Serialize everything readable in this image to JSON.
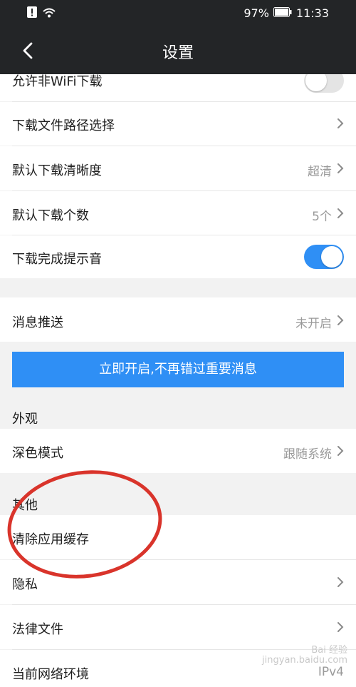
{
  "status_bar": {
    "battery_percent": "97%",
    "time": "11:33",
    "icons": [
      "alert-icon",
      "wifi-icon",
      "battery-icon"
    ]
  },
  "nav": {
    "title": "设置",
    "back_icon": "chevron-left-icon"
  },
  "rows": {
    "allow_non_wifi": {
      "label": "允许非WiFi下载",
      "toggle_on": false
    },
    "download_path": {
      "label": "下载文件路径选择"
    },
    "default_quality": {
      "label": "默认下载清晰度",
      "value": "超清"
    },
    "default_count": {
      "label": "默认下载个数",
      "value": "5个"
    },
    "download_sound": {
      "label": "下载完成提示音",
      "toggle_on": true
    },
    "message_push": {
      "label": "消息推送",
      "value": "未开启"
    },
    "dark_mode": {
      "label": "深色模式",
      "value": "跟随系统"
    },
    "clear_cache": {
      "label": "清除应用缓存"
    },
    "privacy": {
      "label": "隐私"
    },
    "legal": {
      "label": "法律文件"
    },
    "network": {
      "label": "当前网络环境",
      "value": "IPv4"
    }
  },
  "promo_banner": {
    "text": "立即开启,不再错过重要消息"
  },
  "sections": {
    "appearance": "外观",
    "other": "其他"
  },
  "watermark": {
    "line1": "Bai 经验",
    "line2": "jingyan.baidu.com"
  },
  "colors": {
    "header_bg": "#232527",
    "accent_blue": "#2f8ff5",
    "annotation_red": "#d9342b",
    "page_bg": "#f2f2f2"
  }
}
